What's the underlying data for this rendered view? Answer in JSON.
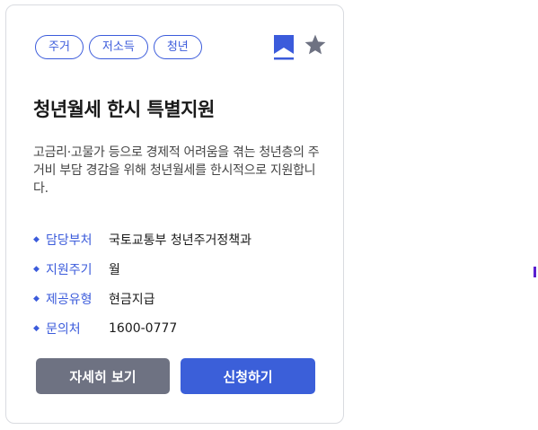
{
  "card": {
    "tags": [
      "주거",
      "저소득",
      "청년"
    ],
    "title": "청년월세 한시 특별지원",
    "description": "고금리·고물가 등으로 경제적 어려움을 겪는 청년층의 주거비 부담 경감을 위해 청년월세를 한시적으로 지원합니다.",
    "info": [
      {
        "label": "담당부처",
        "value": "국토교통부 청년주거정책과"
      },
      {
        "label": "지원주기",
        "value": "월"
      },
      {
        "label": "제공유형",
        "value": "현금지급"
      },
      {
        "label": "문의처",
        "value": "1600-0777"
      }
    ],
    "buttons": {
      "detail": "자세히 보기",
      "apply": "신청하기"
    },
    "icons": {
      "bookmark": "bookmark-icon",
      "star": "star-icon"
    }
  },
  "colors": {
    "accent": "#3b5bdb",
    "secondary_button": "#6e7282",
    "primary_button": "#3b5fd9"
  }
}
